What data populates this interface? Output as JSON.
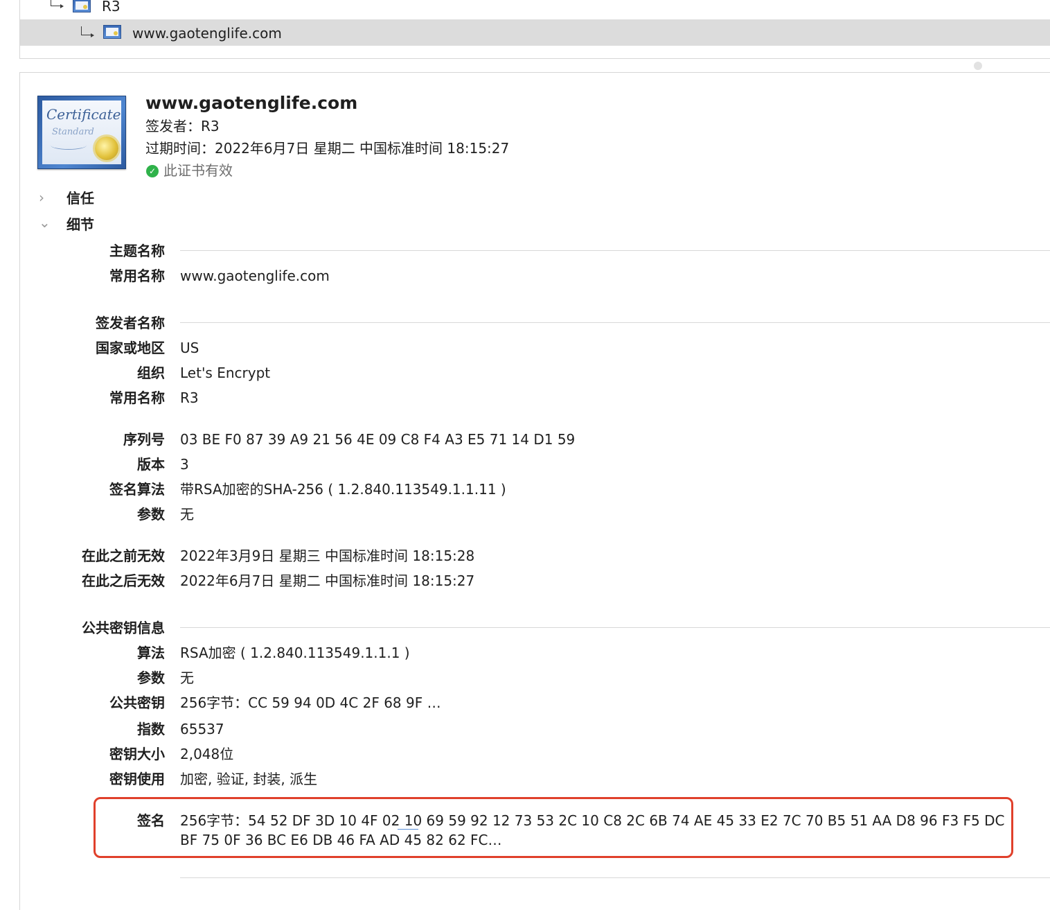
{
  "tree": {
    "parent": {
      "label": "R3",
      "icon": "certificate-icon"
    },
    "selected": {
      "label": "www.gaotenglife.com",
      "icon": "certificate-icon"
    }
  },
  "header": {
    "title": "www.gaotenglife.com",
    "issuer": "签发者：R3",
    "expiry": "过期时间：2022年6月7日 星期二 中国标准时间 18:15:27",
    "valid": "此证书有效",
    "valid_icon": "checkmark-circle-icon",
    "valid_color": "#2fb24a",
    "cert_icon_text": {
      "line1": "Certificate",
      "line2": "Standard"
    }
  },
  "sections": {
    "trust": {
      "label": "信任",
      "disclosure": "›"
    },
    "details": {
      "label": "细节",
      "disclosure": "⌄"
    }
  },
  "subject": {
    "heading": "主题名称",
    "common_name_label": "常用名称",
    "common_name": "www.gaotenglife.com"
  },
  "issuer_name": {
    "heading": "签发者名称",
    "country_label": "国家或地区",
    "country": "US",
    "org_label": "组织",
    "org": "Let's Encrypt",
    "common_name_label": "常用名称",
    "common_name": "R3"
  },
  "cert_info": {
    "serial_label": "序列号",
    "serial": "03 BE F0 87 39 A9 21 56 4E 09 C8 F4 A3 E5 71 14 D1 59",
    "version_label": "版本",
    "version": "3",
    "sig_alg_label": "签名算法",
    "sig_alg": "带RSA加密的SHA-256 ( 1.2.840.113549.1.1.11 )",
    "params_label": "参数",
    "params": "无"
  },
  "validity": {
    "not_before_label": "在此之前无效",
    "not_before": "2022年3月9日 星期三 中国标准时间 18:15:28",
    "not_after_label": "在此之后无效",
    "not_after": "2022年6月7日 星期二 中国标准时间 18:15:27"
  },
  "public_key": {
    "heading": "公共密钥信息",
    "alg_label": "算法",
    "alg": "RSA加密 ( 1.2.840.113549.1.1.1 )",
    "params_label": "参数",
    "params": "无",
    "key_label": "公共密钥",
    "key": "256字节：CC 59 94 0D 4C 2F 68 9F …",
    "exponent_label": "指数",
    "exponent": "65537",
    "size_label": "密钥大小",
    "size": "2,048位",
    "usage_label": "密钥使用",
    "usage": "加密, 验证, 封装, 派生"
  },
  "signature": {
    "label": "签名",
    "value": "256字节：54 52 DF 3D 10 4F 02 10 69 59 92 12 73 53 2C 10 C8 2C 6B 74 AE 45 33 E2 7C 70 B5 51 AA D8 96 F3 F5 DC\nBF 75 0F 36 BC E6 DB 46 FA AD 45 82 62 FC…",
    "highlight_color": "#e0402b"
  }
}
